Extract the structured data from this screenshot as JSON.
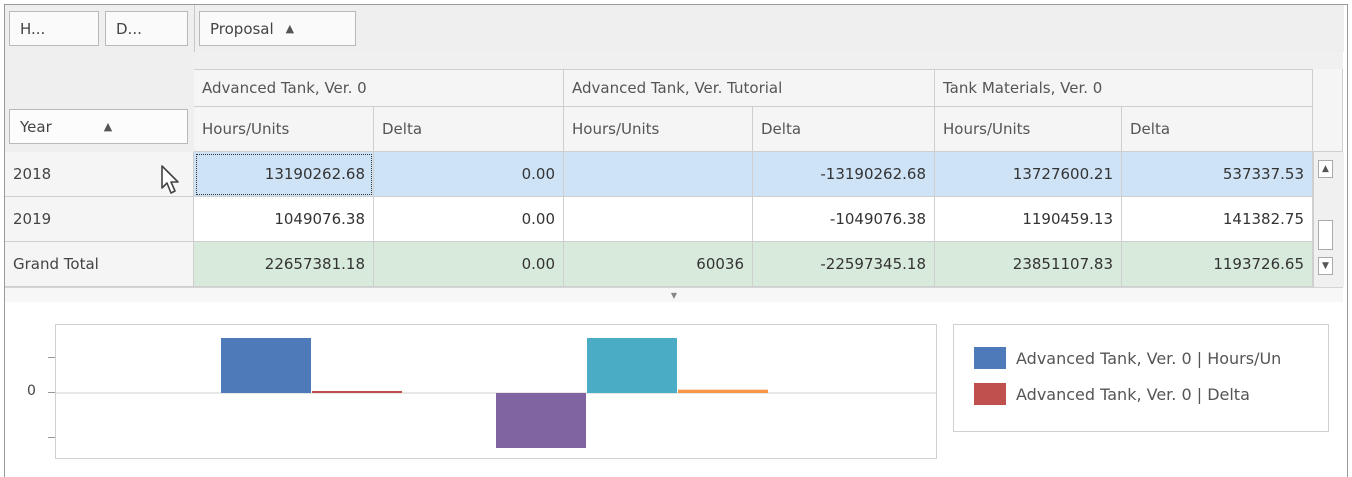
{
  "filter_area": {
    "buttons": [
      "H...",
      "D..."
    ]
  },
  "column_field": {
    "label": "Proposal",
    "sort": "▲"
  },
  "row_field": {
    "label": "Year",
    "sort": "▲"
  },
  "columns": [
    {
      "group": "Advanced Tank, Ver. 0",
      "sub": [
        "Hours/Units",
        "Delta"
      ]
    },
    {
      "group": "Advanced Tank, Ver. Tutorial",
      "sub": [
        "Hours/Units",
        "Delta"
      ]
    },
    {
      "group": "Tank Materials, Ver. 0",
      "sub": [
        "Hours/Units",
        "Delta"
      ]
    }
  ],
  "rows": [
    {
      "label": "2018",
      "values": [
        "13190262.68",
        "0.00",
        "",
        "-13190262.68",
        "13727600.21",
        "537337.53"
      ]
    },
    {
      "label": "2019",
      "values": [
        "1049076.38",
        "0.00",
        "",
        "-1049076.38",
        "1190459.13",
        "141382.75"
      ]
    },
    {
      "label": "Grand Total",
      "values": [
        "22657381.18",
        "0.00",
        "60036",
        "-22597345.18",
        "23851107.83",
        "1193726.65"
      ]
    }
  ],
  "scrollbar": {
    "up": "▲",
    "down": "▼"
  },
  "splitter_glyph": "▼",
  "chart_data": {
    "type": "bar",
    "yticks": [
      "0"
    ],
    "series": [
      {
        "color": "#4e7ab9",
        "value": 1.0
      },
      {
        "color": "#c0504d",
        "value": 0.03
      },
      {
        "color": "#8064a2",
        "value": -1.0
      },
      {
        "color": "#4bacc6",
        "value": 1.0
      },
      {
        "color": "#f79646",
        "value": 0.06
      }
    ]
  },
  "legend": {
    "items": [
      {
        "label": "Advanced Tank, Ver. 0 | Hours/Un",
        "color": "#4e7ab9"
      },
      {
        "label": "Advanced Tank, Ver. 0 | Delta",
        "color": "#c0504d"
      }
    ]
  }
}
